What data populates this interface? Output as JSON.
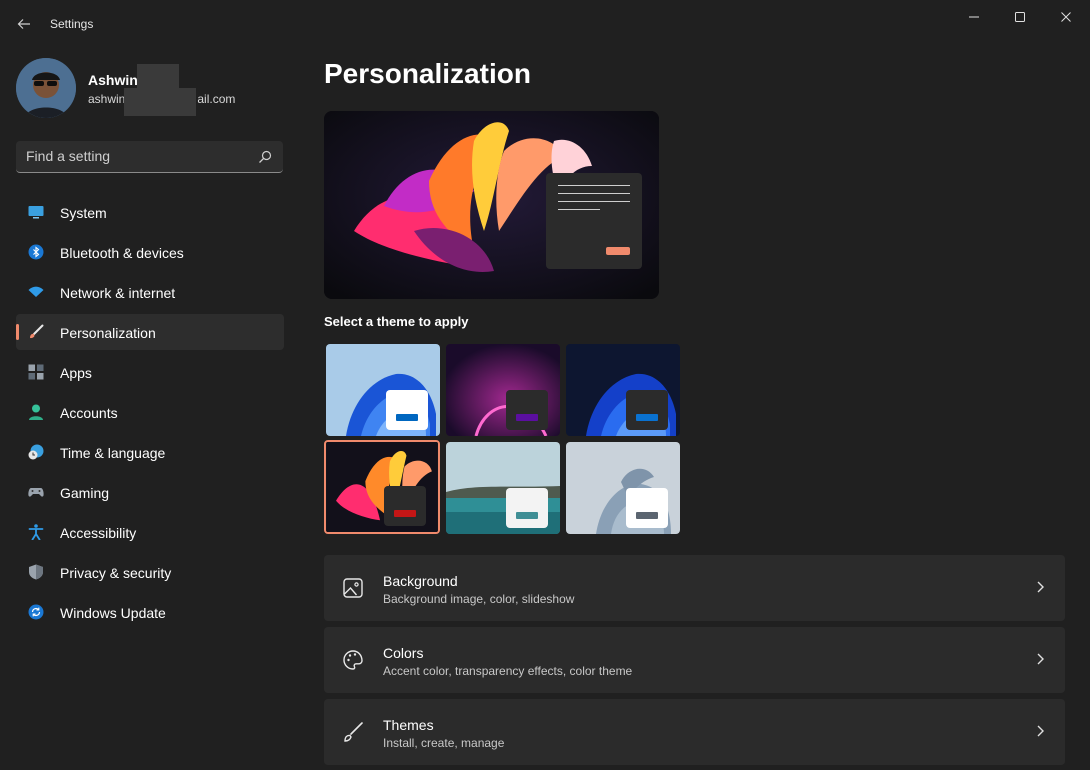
{
  "window": {
    "title": "Settings",
    "controls": [
      "minimize",
      "maximize",
      "close"
    ]
  },
  "profile": {
    "name": "Ashwin",
    "email_visible_prefix": "ashwin",
    "email_visible_suffix": "ail.com"
  },
  "search": {
    "placeholder": "Find a setting",
    "icon": "search-icon"
  },
  "sidebar": {
    "items": [
      {
        "label": "System",
        "icon": "system-icon",
        "active": false
      },
      {
        "label": "Bluetooth & devices",
        "icon": "bluetooth-icon",
        "active": false
      },
      {
        "label": "Network & internet",
        "icon": "network-icon",
        "active": false
      },
      {
        "label": "Personalization",
        "icon": "personalization-brush-icon",
        "active": true
      },
      {
        "label": "Apps",
        "icon": "apps-icon",
        "active": false
      },
      {
        "label": "Accounts",
        "icon": "accounts-icon",
        "active": false
      },
      {
        "label": "Time & language",
        "icon": "time-language-icon",
        "active": false
      },
      {
        "label": "Gaming",
        "icon": "gaming-icon",
        "active": false
      },
      {
        "label": "Accessibility",
        "icon": "accessibility-icon",
        "active": false
      },
      {
        "label": "Privacy & security",
        "icon": "shield-icon",
        "active": false
      },
      {
        "label": "Windows Update",
        "icon": "windows-update-icon",
        "active": false
      }
    ]
  },
  "main": {
    "title": "Personalization",
    "theme_heading": "Select a theme to apply",
    "themes": [
      {
        "name": "windows-light",
        "accent": "#0067c0",
        "selected": false
      },
      {
        "name": "glow",
        "accent": "#5b0fa0",
        "selected": false
      },
      {
        "name": "windows-dark",
        "accent": "#0a72d1",
        "selected": false
      },
      {
        "name": "captured-motion",
        "accent": "#c41616",
        "selected": true
      },
      {
        "name": "sunrise",
        "accent": "#3f8e95",
        "selected": false
      },
      {
        "name": "flow",
        "accent": "#5b6570",
        "selected": false
      }
    ],
    "settings": [
      {
        "title": "Background",
        "subtitle": "Background image, color, slideshow",
        "icon": "picture-icon"
      },
      {
        "title": "Colors",
        "subtitle": "Accent color, transparency effects, color theme",
        "icon": "palette-icon"
      },
      {
        "title": "Themes",
        "subtitle": "Install, create, manage",
        "icon": "brush-icon"
      }
    ]
  },
  "colors": {
    "background": "#202020",
    "card": "#2b2b2b",
    "accent": "#f08a6c"
  }
}
